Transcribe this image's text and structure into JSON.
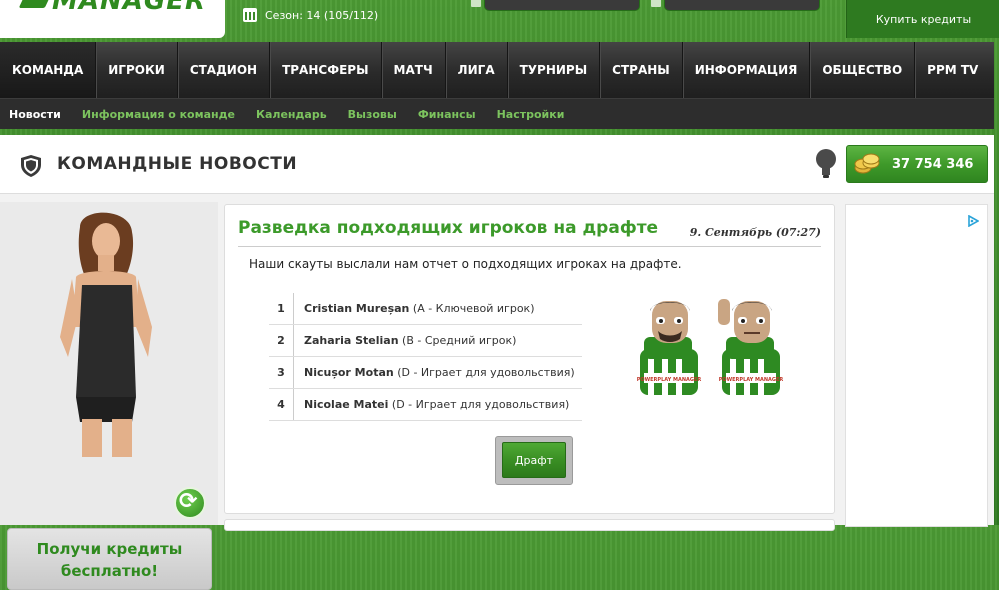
{
  "header": {
    "logo_text": "MANAGER",
    "season": "Сезон: 14 (105/112)",
    "buy_credits": "Купить кредиты"
  },
  "main_nav": [
    {
      "label": "КОМАНДА",
      "active": true
    },
    {
      "label": "ИГРОКИ"
    },
    {
      "label": "СТАДИОН"
    },
    {
      "label": "ТРАНСФЕРЫ"
    },
    {
      "label": "МАТЧ"
    },
    {
      "label": "ЛИГА"
    },
    {
      "label": "ТУРНИРЫ"
    },
    {
      "label": "СТРАНЫ"
    },
    {
      "label": "ИНФОРМАЦИЯ"
    },
    {
      "label": "ОБЩЕСТВО"
    },
    {
      "label": "PPM TV"
    }
  ],
  "sub_nav": [
    {
      "label": "Новости",
      "active": true
    },
    {
      "label": "Информация о команде"
    },
    {
      "label": "Календарь"
    },
    {
      "label": "Вызовы"
    },
    {
      "label": "Финансы"
    },
    {
      "label": "Настройки"
    }
  ],
  "section": {
    "title": "КОМАНДНЫЕ НОВОСТИ",
    "credits": "37 754 346"
  },
  "promo": {
    "line1": "Получи кредиты",
    "line2": "бесплатно!"
  },
  "article": {
    "title": "Разведка подходящих игроков на драфте",
    "date": "9. Сентябрь (07:27)",
    "intro": "Наши скауты выслали нам отчет о подходящих игроках на драфте.",
    "players": [
      {
        "num": "1",
        "name": "Cristian Mureșan",
        "detail": " (A - Ключевой игрок)"
      },
      {
        "num": "2",
        "name": "Zaharia Stelian",
        "detail": " (B - Средний игрок)"
      },
      {
        "num": "3",
        "name": "Nicușor Motan",
        "detail": " (D - Играет для удовольствия)"
      },
      {
        "num": "4",
        "name": "Nicolae Matei",
        "detail": " (D - Играет для удовольствия)"
      }
    ],
    "button": "Драфт",
    "jersey_text": "POWERPLAY MANAGER"
  },
  "colors": {
    "accent": "#3c9a2a",
    "nav_bg": "#2a2a2a",
    "link_green": "#7cc35e"
  },
  "icons": [
    "calendar-icon",
    "shield-icon",
    "bulb-icon",
    "coins-icon",
    "refresh-icon",
    "adchoices-icon"
  ]
}
